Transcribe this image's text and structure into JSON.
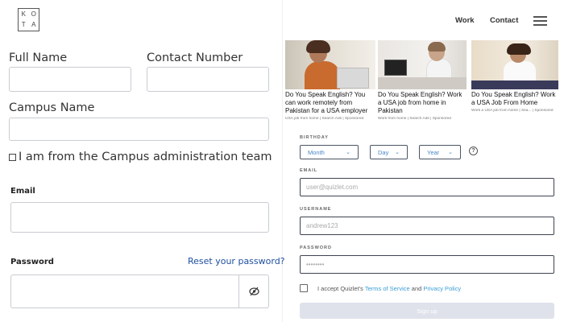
{
  "header": {
    "logo_letters": [
      "K",
      "O",
      "T",
      "A"
    ],
    "nav": [
      {
        "label": "Work"
      },
      {
        "label": "Contact"
      }
    ],
    "menu_icon": "hamburger-menu-icon"
  },
  "left_form": {
    "full_name_label": "Full Name",
    "contact_number_label": "Contact Number",
    "campus_name_label": "Campus Name",
    "admin_checkbox_label": "I am from the Campus administration team",
    "email_label": "Email",
    "password_label": "Password",
    "reset_link": "Reset your password?",
    "password_toggle_icon": "eye-slash-icon"
  },
  "ads": [
    {
      "title": "Do You Speak English? You can work remotely from Pakistan for a USA employer",
      "source": "USA job from home | Search Ads | Sponsored"
    },
    {
      "title": "Do You Speak English? Work a USA job from home in Pakistan",
      "source": "Work from home | Search Ads | Sponsored"
    },
    {
      "title": "Do You Speak English? Work a USA Job From Home",
      "source": "Work a USA job from home | Sea... | Sponsored"
    }
  ],
  "signup_form": {
    "birthday_label": "BIRTHDAY",
    "month_select": "Month",
    "day_select": "Day",
    "year_select": "Year",
    "help_icon": "question-circle-icon",
    "email_label": "EMAIL",
    "email_placeholder": "user@quizlet.com",
    "username_label": "USERNAME",
    "username_placeholder": "andrew123",
    "password_label": "PASSWORD",
    "password_placeholder": "••••••••",
    "accept_prefix": "I accept Quizlet's",
    "terms_link": "Terms of Service",
    "accept_and": "and",
    "privacy_link": "Privacy Policy",
    "signup_button": "Sign up"
  },
  "colors": {
    "link_blue": "#1f4fa0",
    "quizlet_link": "#3b9dd6",
    "signup_disabled": "#dfe2ea"
  }
}
